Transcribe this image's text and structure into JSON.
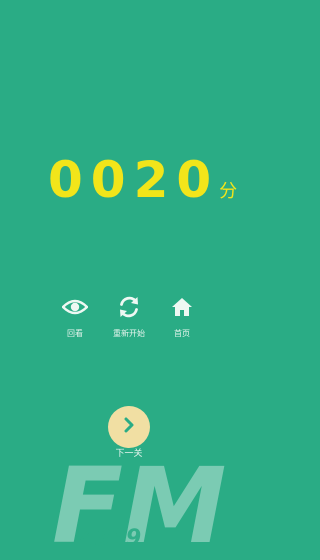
{
  "score": {
    "value": "0020",
    "unit": "分"
  },
  "actions": {
    "review_label": "回看",
    "restart_label": "重新开始",
    "home_label": "首页"
  },
  "next": {
    "label": "下一关"
  },
  "watermark": {
    "logo_text": "FM",
    "logo_number": "4399"
  },
  "colors": {
    "background": "#2aac85",
    "score": "#f2e51a",
    "next_button": "#f1dfa3",
    "icon": "#eef8f3"
  },
  "icons": {
    "review": "eye-icon",
    "restart": "refresh-icon",
    "home": "home-icon",
    "next": "chevron-right-icon"
  }
}
